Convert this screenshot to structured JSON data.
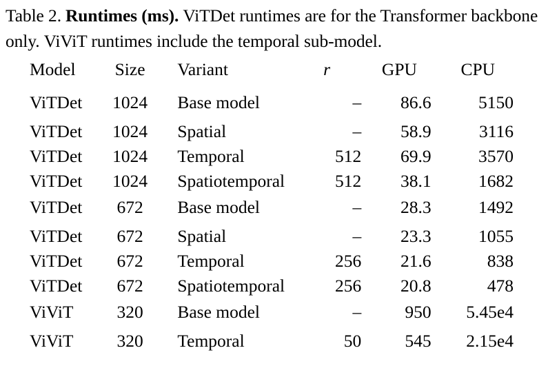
{
  "caption": {
    "label": "Table 2.",
    "bold_title": "Runtimes (ms).",
    "text": "ViTDet runtimes are for the Transformer backbone only.",
    "text2": "ViViT runtimes include the temporal sub-model."
  },
  "table": {
    "columns": [
      {
        "key": "model",
        "label": "Model"
      },
      {
        "key": "size",
        "label": "Size"
      },
      {
        "key": "variant",
        "label": "Variant"
      },
      {
        "key": "r",
        "label": "r"
      },
      {
        "key": "gpu",
        "label": "GPU"
      },
      {
        "key": "cpu",
        "label": "CPU"
      }
    ],
    "blocks": [
      {
        "rows": [
          {
            "model": "ViTDet",
            "size": "1024",
            "variant": "Base model",
            "r": "–",
            "gpu": "86.6",
            "cpu": "5150"
          },
          {
            "model": "ViTDet",
            "size": "1024",
            "variant": "Spatial",
            "r": "–",
            "gpu": "58.9",
            "cpu": "3116"
          },
          {
            "model": "ViTDet",
            "size": "1024",
            "variant": "Temporal",
            "r": "512",
            "gpu": "69.9",
            "cpu": "3570"
          },
          {
            "model": "ViTDet",
            "size": "1024",
            "variant": "Spatiotemporal",
            "r": "512",
            "gpu": "38.1",
            "cpu": "1682"
          }
        ]
      },
      {
        "rows": [
          {
            "model": "ViTDet",
            "size": "672",
            "variant": "Base model",
            "r": "–",
            "gpu": "28.3",
            "cpu": "1492"
          },
          {
            "model": "ViTDet",
            "size": "672",
            "variant": "Spatial",
            "r": "–",
            "gpu": "23.3",
            "cpu": "1055"
          },
          {
            "model": "ViTDet",
            "size": "672",
            "variant": "Temporal",
            "r": "256",
            "gpu": "21.6",
            "cpu": "838"
          },
          {
            "model": "ViTDet",
            "size": "672",
            "variant": "Spatiotemporal",
            "r": "256",
            "gpu": "20.8",
            "cpu": "478"
          }
        ]
      },
      {
        "rows": [
          {
            "model": "ViViT",
            "size": "320",
            "variant": "Base model",
            "r": "–",
            "gpu": "950",
            "cpu": "5.45e4"
          },
          {
            "model": "ViViT",
            "size": "320",
            "variant": "Temporal",
            "r": "50",
            "gpu": "545",
            "cpu": "2.15e4"
          }
        ]
      }
    ]
  }
}
